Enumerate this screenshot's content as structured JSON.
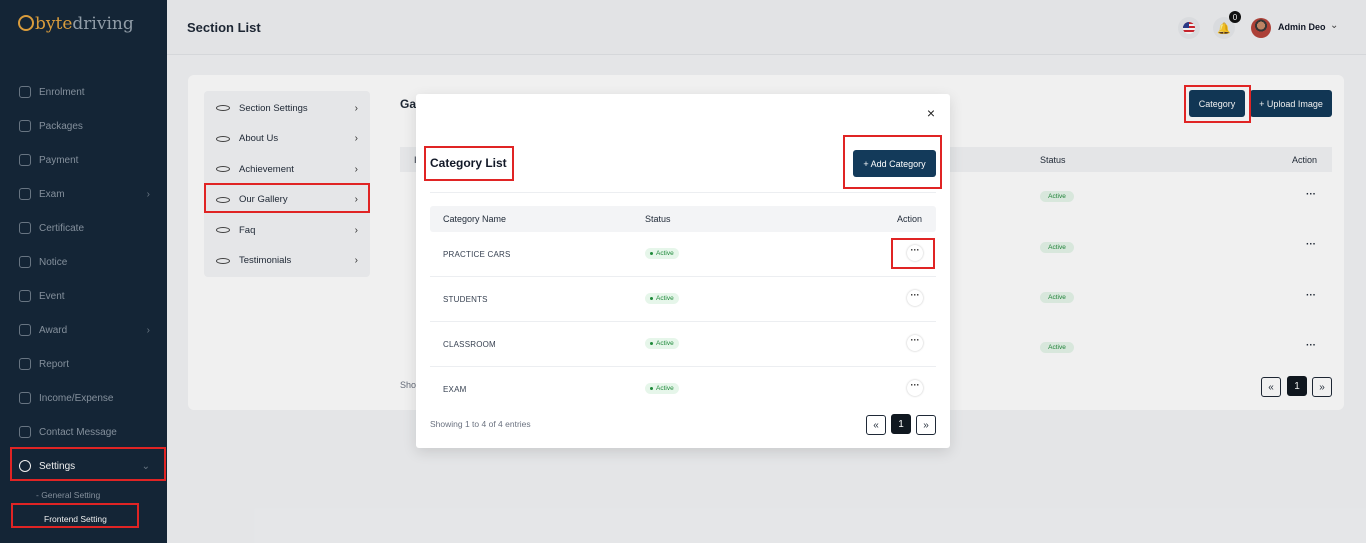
{
  "brand": {
    "part1": "byte",
    "part2": "driving"
  },
  "sidebar": {
    "items": [
      {
        "label": "Enrolment"
      },
      {
        "label": "Packages"
      },
      {
        "label": "Payment"
      },
      {
        "label": "Exam",
        "chevron": "›"
      },
      {
        "label": "Certificate"
      },
      {
        "label": "Notice"
      },
      {
        "label": "Event"
      },
      {
        "label": "Award",
        "chevron": "›"
      },
      {
        "label": "Report"
      },
      {
        "label": "Income/Expense"
      },
      {
        "label": "Contact Message"
      },
      {
        "label": "Settings",
        "chevron": "⌄"
      }
    ],
    "sub_items": [
      {
        "label": "- General Setting"
      },
      {
        "label": "Frontend Setting"
      }
    ]
  },
  "header": {
    "title": "Section List",
    "notification_count": "0",
    "user_name": "Admin Deo"
  },
  "section_menu": {
    "items": [
      {
        "label": "Section Settings"
      },
      {
        "label": "About Us"
      },
      {
        "label": "Achievement"
      },
      {
        "label": "Our Gallery"
      },
      {
        "label": "Faq"
      },
      {
        "label": "Testimonials"
      }
    ]
  },
  "background_page": {
    "heading": "Ga",
    "category_button": "Category",
    "upload_button": "+ Upload Image",
    "table_head_left": "I",
    "status_header": "Status",
    "action_header": "Action",
    "row_status": "Active",
    "showing_partial": "Sho",
    "current_page": "1"
  },
  "modal": {
    "close_label": "×",
    "title": "Category List",
    "add_button": "+ Add Category",
    "columns": {
      "name": "Category Name",
      "status": "Status",
      "action": "Action"
    },
    "rows": [
      {
        "name": "PRACTICE CARS",
        "status": "Active"
      },
      {
        "name": "STUDENTS",
        "status": "Active"
      },
      {
        "name": "CLASSROOM",
        "status": "Active"
      },
      {
        "name": "EXAM",
        "status": "Active"
      }
    ],
    "showing": "Showing 1 to 4 of 4 entries",
    "pagination": {
      "prev": "«",
      "current": "1",
      "next": "»"
    }
  },
  "colors": {
    "sidebar_bg": "#16283a",
    "brand": "#e7a640",
    "primary_button": "#133a5a",
    "active_badge": "#1f8a3a",
    "highlight_box": "#e02424"
  }
}
